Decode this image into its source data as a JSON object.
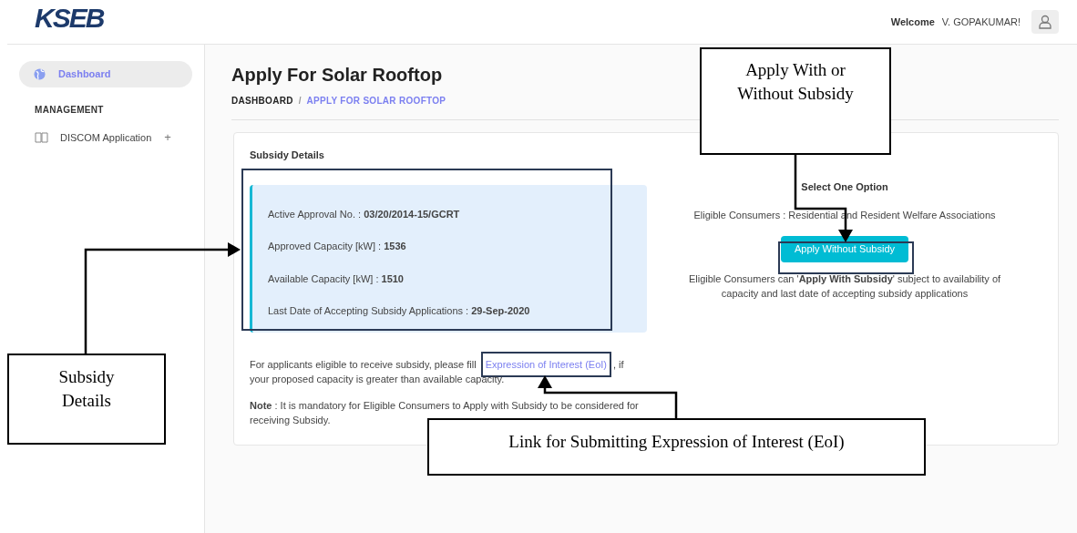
{
  "header": {
    "logo": "KSEB",
    "welcome": "Welcome",
    "user": "V. GOPAKUMAR!"
  },
  "sidebar": {
    "items": [
      {
        "kind": "link",
        "label": "Dashboard",
        "selected": true
      },
      {
        "kind": "section",
        "label": "MANAGEMENT"
      },
      {
        "kind": "expandable",
        "label": "DISCOM Application",
        "glyph": "+",
        "selected": false
      }
    ]
  },
  "page": {
    "title": "Apply For Solar Rooftop",
    "breadcrumb": [
      {
        "label": "DASHBOARD",
        "selected": false
      },
      {
        "label": "/",
        "kind": "separator"
      },
      {
        "label": "APPLY FOR SOLAR ROOFTOP",
        "selected": true
      }
    ]
  },
  "card": {
    "heading": "Subsidy Details",
    "details": [
      "Active Approval No. : **03/20/2014-15/GCRT**",
      "Approved Capacity [kW] : **1536**",
      "Available Capacity [kW] : **1510**",
      "Last Date of Accepting Subsidy Applications : **29-Sep-2020**"
    ],
    "eoi": {
      "before": "For applicants eligible to receive subsidy, please fill ",
      "link": "Expression of Interest (EoI)",
      "after": ", if your proposed capacity is greater than available capacity."
    },
    "note": "**Note** : It is mandatory for Eligible Consumers to Apply with Subsidy to be considered for receiving Subsidy.",
    "options": {
      "heading": "Select One Option",
      "eligible": "Eligible Consumers : Residential and Resident Welfare Associations",
      "button": "Apply Without Subsidy",
      "info": "Eligible Consumers can '**Apply With Subsidy**' subject to availability of capacity and last date of accepting subsidy applications"
    }
  },
  "annotations": [
    {
      "text": "Apply With or Without Subsidy"
    },
    {
      "text": "Subsidy Details"
    },
    {
      "text": "Link for Submitting Expression of Interest (EoI)"
    }
  ]
}
